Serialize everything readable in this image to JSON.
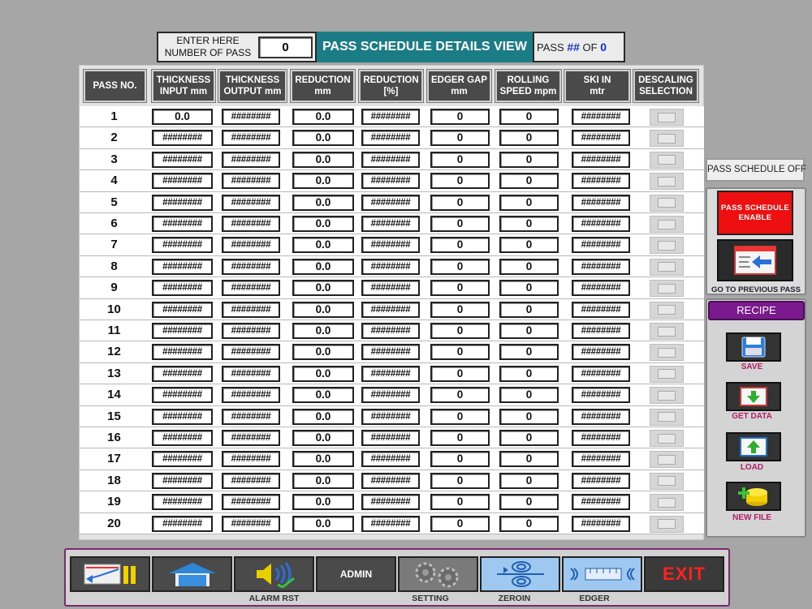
{
  "header": {
    "enter_label_line1": "ENTER HERE",
    "enter_label_line2": "NUMBER OF PASS",
    "number_of_pass": "0",
    "title": "PASS SCHEDULE DETAILS VIEW",
    "pass_label": "PASS",
    "pass_current": "##",
    "of_label": "OF",
    "pass_total": "0"
  },
  "columns": [
    {
      "line1": "PASS NO.",
      "line2": ""
    },
    {
      "line1": "THICKNESS",
      "line2": "INPUT mm"
    },
    {
      "line1": "THICKNESS",
      "line2": "OUTPUT mm"
    },
    {
      "line1": "REDUCTION",
      "line2": "mm"
    },
    {
      "line1": "REDUCTION",
      "line2": "[%]"
    },
    {
      "line1": "EDGER GAP",
      "line2": "mm"
    },
    {
      "line1": "ROLLING",
      "line2": "SPEED mpm"
    },
    {
      "line1": "SKI IN",
      "line2": "mtr"
    },
    {
      "line1": "DESCALING",
      "line2": "SELECTION"
    }
  ],
  "rows": [
    {
      "pass": "1",
      "thk_in": "0.0",
      "thk_out": "########",
      "red_mm": "0.0",
      "red_pct": "########",
      "edger": "0",
      "speed": "0",
      "ski": "########"
    },
    {
      "pass": "2",
      "thk_in": "########",
      "thk_out": "########",
      "red_mm": "0.0",
      "red_pct": "########",
      "edger": "0",
      "speed": "0",
      "ski": "########"
    },
    {
      "pass": "3",
      "thk_in": "########",
      "thk_out": "########",
      "red_mm": "0.0",
      "red_pct": "########",
      "edger": "0",
      "speed": "0",
      "ski": "########"
    },
    {
      "pass": "4",
      "thk_in": "########",
      "thk_out": "########",
      "red_mm": "0.0",
      "red_pct": "########",
      "edger": "0",
      "speed": "0",
      "ski": "########"
    },
    {
      "pass": "5",
      "thk_in": "########",
      "thk_out": "########",
      "red_mm": "0.0",
      "red_pct": "########",
      "edger": "0",
      "speed": "0",
      "ski": "########"
    },
    {
      "pass": "6",
      "thk_in": "########",
      "thk_out": "########",
      "red_mm": "0.0",
      "red_pct": "########",
      "edger": "0",
      "speed": "0",
      "ski": "########"
    },
    {
      "pass": "7",
      "thk_in": "########",
      "thk_out": "########",
      "red_mm": "0.0",
      "red_pct": "########",
      "edger": "0",
      "speed": "0",
      "ski": "########"
    },
    {
      "pass": "8",
      "thk_in": "########",
      "thk_out": "########",
      "red_mm": "0.0",
      "red_pct": "########",
      "edger": "0",
      "speed": "0",
      "ski": "########"
    },
    {
      "pass": "9",
      "thk_in": "########",
      "thk_out": "########",
      "red_mm": "0.0",
      "red_pct": "########",
      "edger": "0",
      "speed": "0",
      "ski": "########"
    },
    {
      "pass": "10",
      "thk_in": "########",
      "thk_out": "########",
      "red_mm": "0.0",
      "red_pct": "########",
      "edger": "0",
      "speed": "0",
      "ski": "########"
    },
    {
      "pass": "11",
      "thk_in": "########",
      "thk_out": "########",
      "red_mm": "0.0",
      "red_pct": "########",
      "edger": "0",
      "speed": "0",
      "ski": "########"
    },
    {
      "pass": "12",
      "thk_in": "########",
      "thk_out": "########",
      "red_mm": "0.0",
      "red_pct": "########",
      "edger": "0",
      "speed": "0",
      "ski": "########"
    },
    {
      "pass": "13",
      "thk_in": "########",
      "thk_out": "########",
      "red_mm": "0.0",
      "red_pct": "########",
      "edger": "0",
      "speed": "0",
      "ski": "########"
    },
    {
      "pass": "14",
      "thk_in": "########",
      "thk_out": "########",
      "red_mm": "0.0",
      "red_pct": "########",
      "edger": "0",
      "speed": "0",
      "ski": "########"
    },
    {
      "pass": "15",
      "thk_in": "########",
      "thk_out": "########",
      "red_mm": "0.0",
      "red_pct": "########",
      "edger": "0",
      "speed": "0",
      "ski": "########"
    },
    {
      "pass": "16",
      "thk_in": "########",
      "thk_out": "########",
      "red_mm": "0.0",
      "red_pct": "########",
      "edger": "0",
      "speed": "0",
      "ski": "########"
    },
    {
      "pass": "17",
      "thk_in": "########",
      "thk_out": "########",
      "red_mm": "0.0",
      "red_pct": "########",
      "edger": "0",
      "speed": "0",
      "ski": "########"
    },
    {
      "pass": "18",
      "thk_in": "########",
      "thk_out": "########",
      "red_mm": "0.0",
      "red_pct": "########",
      "edger": "0",
      "speed": "0",
      "ski": "########"
    },
    {
      "pass": "19",
      "thk_in": "########",
      "thk_out": "########",
      "red_mm": "0.0",
      "red_pct": "########",
      "edger": "0",
      "speed": "0",
      "ski": "########"
    },
    {
      "pass": "20",
      "thk_in": "########",
      "thk_out": "########",
      "red_mm": "0.0",
      "red_pct": "########",
      "edger": "0",
      "speed": "0",
      "ski": "########"
    }
  ],
  "right_panel": {
    "status": "PASS SCHEDULE OFF",
    "enable_line1": "PASS SCHEDULE",
    "enable_line2": "ENABLE",
    "prev_label": "GO TO PREVIOUS PASS",
    "recipe_title": "RECIPE",
    "save_label": "SAVE",
    "get_data_label": "GET DATA",
    "load_label": "LOAD",
    "new_file_label": "NEW FILE"
  },
  "bottom": {
    "alarm_label": "ALARM RST",
    "admin_label": "ADMIN",
    "setting_label": "SETTING",
    "zeroin_label": "ZEROIN",
    "edger_label": "EDGER",
    "exit_label": "EXIT"
  },
  "colors": {
    "title_bg": "#1b7c85",
    "enable_bg": "#ee1010",
    "recipe_bg": "#7a1a8e",
    "recipe_label": "#b0206a",
    "exit_text": "#ff2020"
  }
}
